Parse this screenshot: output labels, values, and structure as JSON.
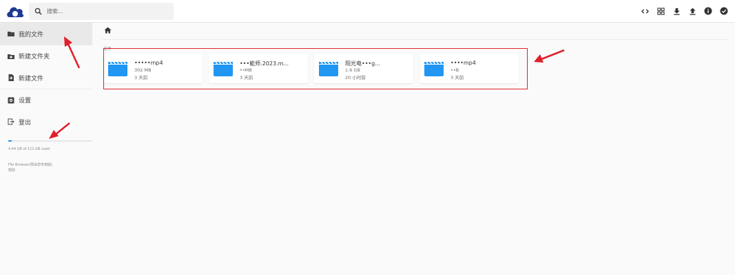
{
  "header": {
    "search_placeholder": "搜索...",
    "actions": [
      "code-icon",
      "grid-icon",
      "download-icon",
      "upload-icon",
      "info-icon",
      "check-circle-icon"
    ]
  },
  "sidebar": {
    "items": [
      {
        "label": "我的文件",
        "icon": "folder-icon"
      },
      {
        "label": "新建文件夹",
        "icon": "new-folder-icon"
      },
      {
        "label": "新建文件",
        "icon": "new-file-icon"
      },
      {
        "label": "设置",
        "icon": "settings-icon"
      },
      {
        "label": "登出",
        "icon": "logout-icon"
      }
    ],
    "usage": {
      "text": "4.44 GB of 111 GB used",
      "fraction": 0.04
    },
    "footer": [
      "File Browser(周由您专用版)",
      "帮助"
    ]
  },
  "main": {
    "section_label": "文件",
    "files": [
      {
        "name": "•••••mp4",
        "size": "302 MB",
        "time": "3 天前"
      },
      {
        "name": "•••能师.2023.m...",
        "size": "••MB",
        "time": "3 天前"
      },
      {
        "name": "阳光电•••g...",
        "size": "1.6 GB",
        "time": "20 小时前"
      },
      {
        "name": "••••mp4",
        "size": "••B",
        "time": "3 天前"
      }
    ]
  },
  "colors": {
    "accent": "#2196f3",
    "annotation": "#e0202a"
  }
}
